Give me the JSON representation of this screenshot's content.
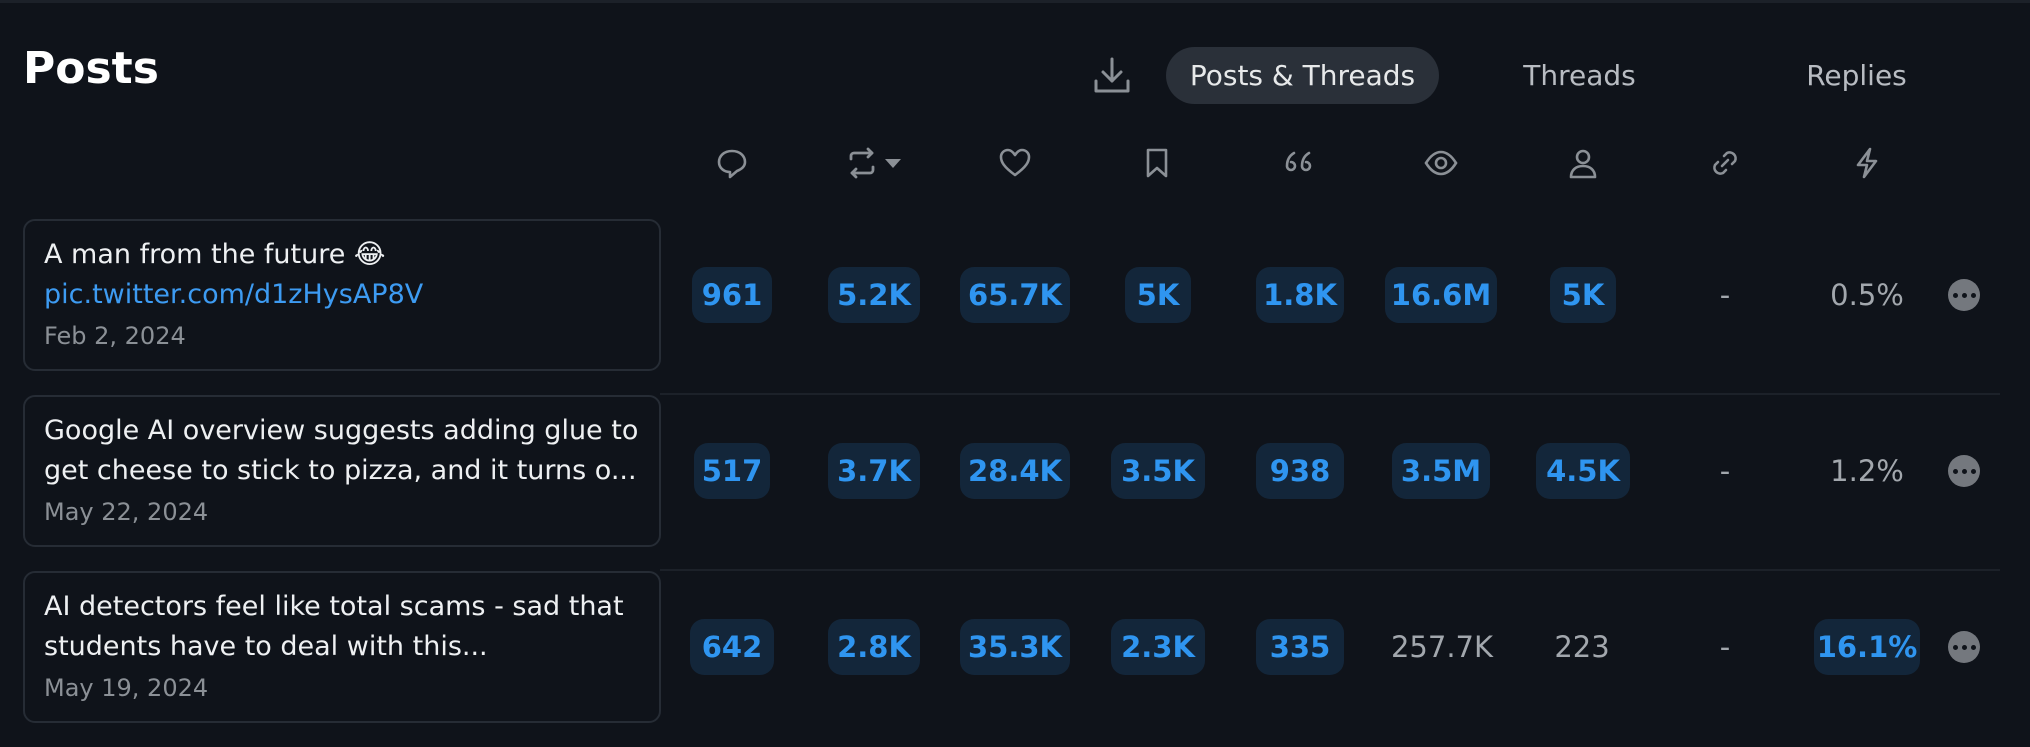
{
  "page": {
    "title": "Posts"
  },
  "tabs": [
    {
      "label": "Posts & Threads",
      "active": true
    },
    {
      "label": "Threads",
      "active": false
    },
    {
      "label": "Replies",
      "active": false
    }
  ],
  "columns": [
    {
      "icon": "reply-icon"
    },
    {
      "icon": "repost-sort-icon"
    },
    {
      "icon": "heart-icon"
    },
    {
      "icon": "bookmark-icon"
    },
    {
      "icon": "quote-icon"
    },
    {
      "icon": "eye-icon"
    },
    {
      "icon": "person-icon"
    },
    {
      "icon": "link-icon"
    },
    {
      "icon": "lightning-icon"
    }
  ],
  "posts": [
    {
      "text": "A man from the future 😂",
      "link": "pic.twitter.com/d1zHysAP8V",
      "date": "Feb 2, 2024",
      "stats": [
        "961",
        "5.2K",
        "65.7K",
        "5K",
        "1.8K",
        "16.6M",
        "5K",
        "-",
        "0.5%"
      ]
    },
    {
      "text": "Google AI overview suggests adding glue to",
      "text2": "get cheese to stick to pizza, and it turns o...",
      "date": "May 22, 2024",
      "stats": [
        "517",
        "3.7K",
        "28.4K",
        "3.5K",
        "938",
        "3.5M",
        "4.5K",
        "-",
        "1.2%"
      ]
    },
    {
      "text": "AI detectors feel like total scams - sad that",
      "text2": "students have to deal with this...",
      "date": "May 19, 2024",
      "stats": [
        "642",
        "2.8K",
        "35.3K",
        "2.3K",
        "335",
        "257.7K",
        "223",
        "-",
        "16.1%"
      ]
    }
  ],
  "colors": {
    "accent": "#2f95f0",
    "pill_bg": "#13263a",
    "background": "#0f131a"
  }
}
